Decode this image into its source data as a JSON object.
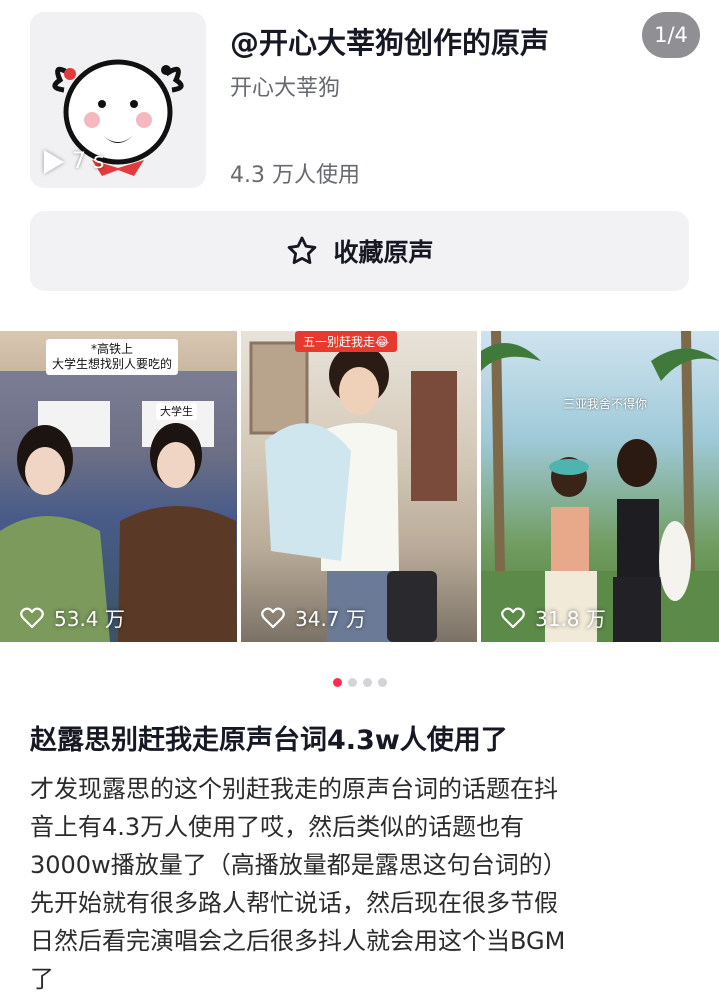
{
  "sound": {
    "title": "@开心大莘狗创作的原声",
    "author": "开心大莘狗",
    "usage": "4.3 万人使用",
    "duration": "7 s",
    "page_indicator": "1/4"
  },
  "favorite_button": {
    "label": "收藏原声"
  },
  "videos": [
    {
      "likes": "53.4 万",
      "caption_lines": [
        "*高铁上",
        "大学生想找别人要吃的"
      ],
      "sign_text": "大学生"
    },
    {
      "likes": "34.7 万",
      "tag": "五一别赶我走😂"
    },
    {
      "likes": "31.8 万",
      "overlay": "三亚我舍不得你"
    }
  ],
  "carousel": {
    "count": 4,
    "active_index": 0
  },
  "post": {
    "title": "赵露思别赶我走原声台词4.3w人使用了",
    "body_lines": [
      "才发现露思的这个别赶我走的原声台词的话题在抖",
      "音上有4.3万人使用了哎，然后类似的话题也有",
      "3000w播放量了（高播放量都是露思这句台词的）",
      "先开始就有很多路人帮忙说话，然后现在很多节假",
      "日然后看完演唱会之后很多抖人就会用这个当BGM",
      "了"
    ]
  },
  "colors": {
    "accent": "#fe2c55",
    "badge_bg": "#8f8f94",
    "button_bg": "#f2f2f4"
  }
}
